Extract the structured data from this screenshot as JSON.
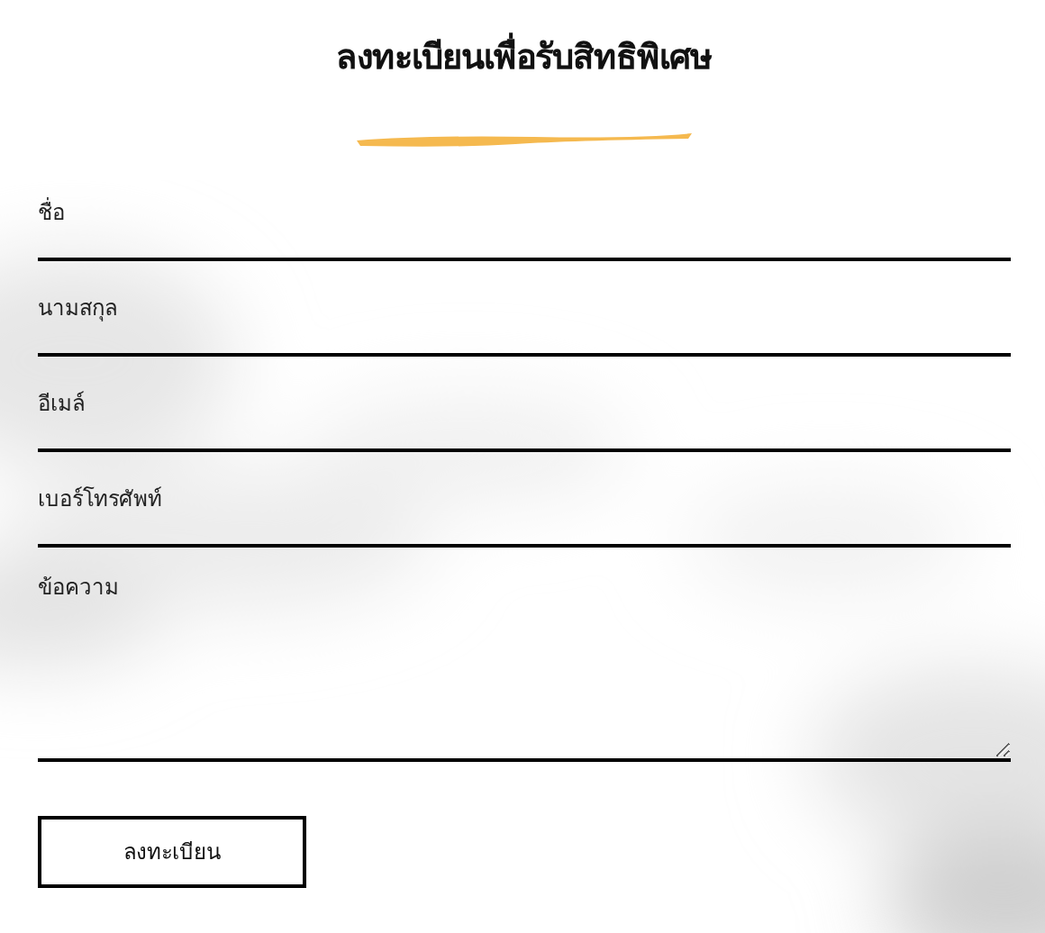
{
  "title": "ลงทะเบียนเพื่อรับสิทธิพิเศษ",
  "fields": [
    {
      "kind": "input",
      "label": "ชื่อ"
    },
    {
      "kind": "input",
      "label": "นามสกุล"
    },
    {
      "kind": "input",
      "label": "อีเมล์"
    },
    {
      "kind": "input",
      "label": "เบอร์โทรศัพท์"
    },
    {
      "kind": "textarea",
      "label": "ข้อความ"
    }
  ],
  "submit_button": "ลงทะเบียน"
}
